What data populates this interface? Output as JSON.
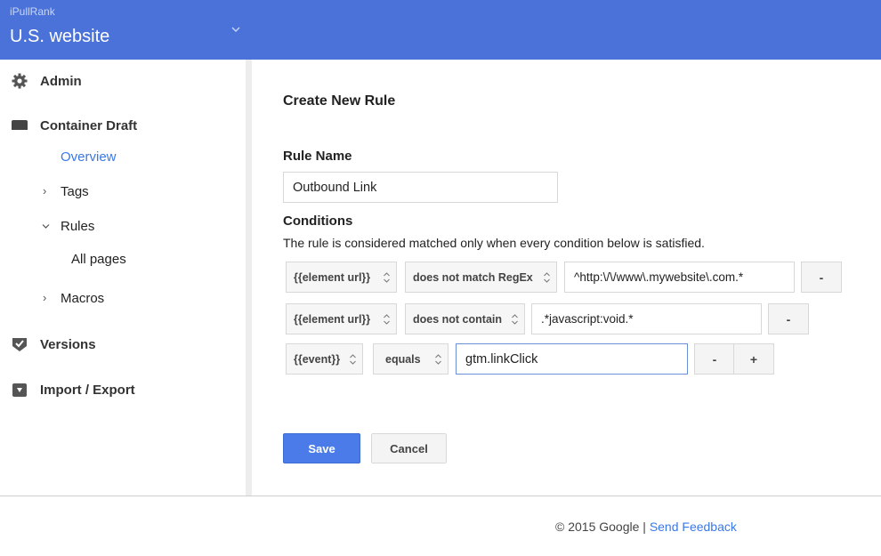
{
  "header": {
    "account": "iPullRank",
    "container": "U.S. website"
  },
  "sidebar": {
    "admin": "Admin",
    "container_draft": "Container Draft",
    "overview": "Overview",
    "tags": "Tags",
    "rules": "Rules",
    "all_pages": "All pages",
    "macros": "Macros",
    "versions": "Versions",
    "import_export": "Import / Export"
  },
  "main": {
    "title": "Create New Rule",
    "rule_name_label": "Rule Name",
    "rule_name_value": "Outbound Link",
    "conditions_label": "Conditions",
    "conditions_desc": "The rule is considered matched only when every condition below is satisfied.",
    "conditions": [
      {
        "macro": "{{element url}}",
        "operator": "does not match RegEx",
        "value": "^http:\\/\\/www\\.mywebsite\\.com.*",
        "remove": "-"
      },
      {
        "macro": "{{element url}}",
        "operator": "does not contain",
        "value": ".*javascript:void.*",
        "remove": "-"
      },
      {
        "macro": "{{event}}",
        "operator": "equals",
        "value": "gtm.linkClick",
        "remove": "-",
        "add": "+"
      }
    ],
    "save": "Save",
    "cancel": "Cancel"
  },
  "footer": {
    "copyright": "© 2015 Google | ",
    "feedback": "Send Feedback"
  }
}
